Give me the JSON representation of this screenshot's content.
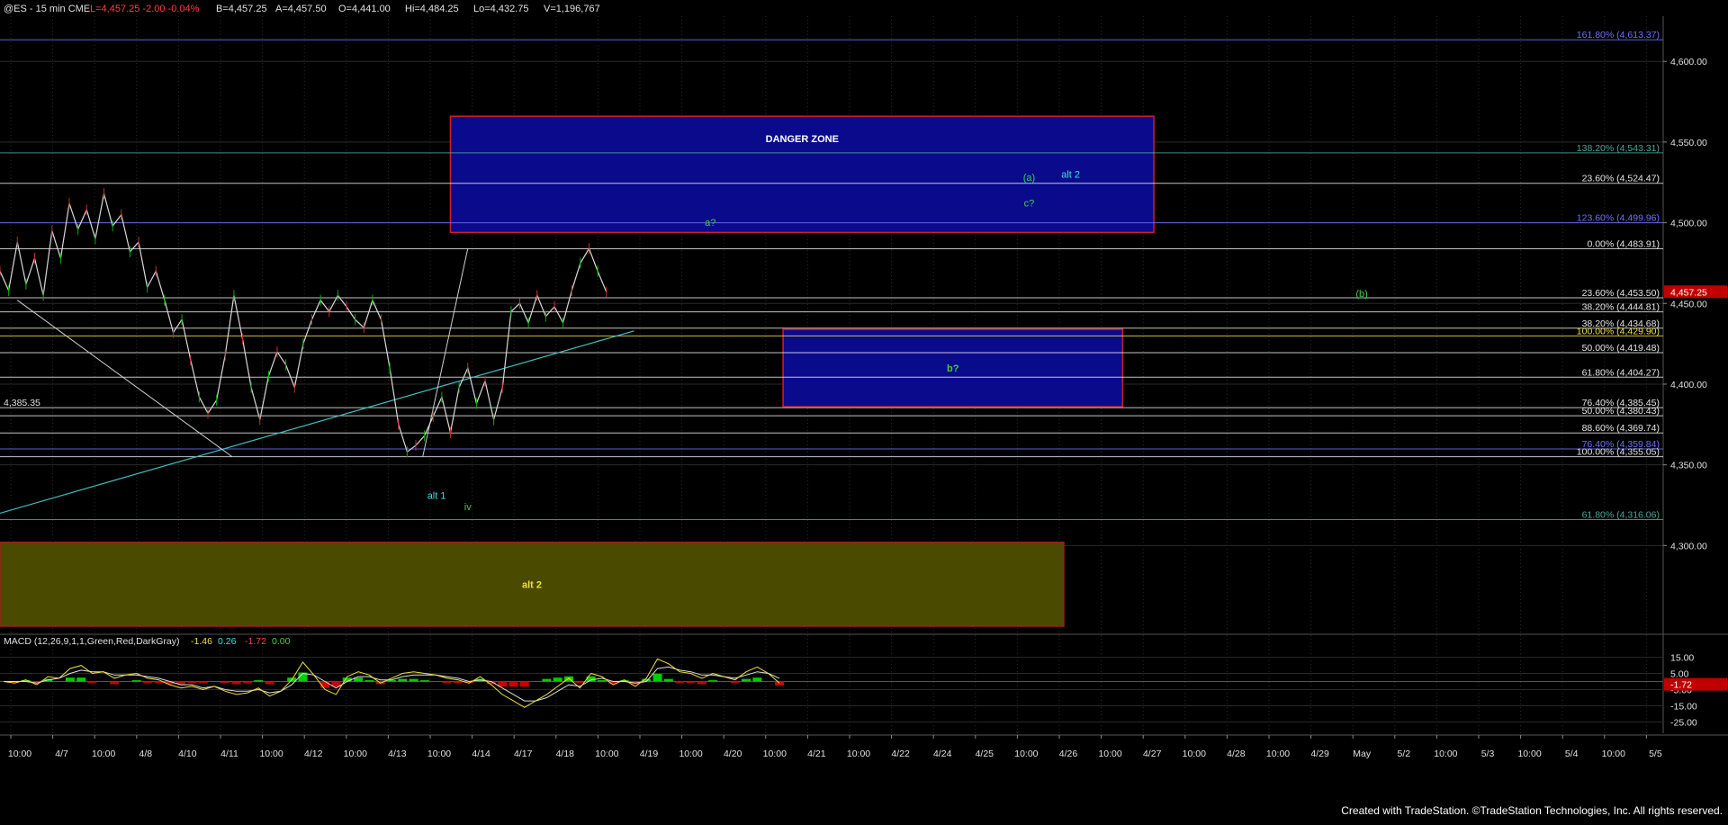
{
  "header": {
    "symbol": "@ES - 15 min  CME",
    "last": "L=4,457.25  -2.00  -0.04%",
    "bid": "B=4,457.25",
    "ask": "A=4,457.50",
    "open": "O=4,441.00",
    "high": "Hi=4,484.25",
    "low": "Lo=4,432.75",
    "volume": "V=1,196,767"
  },
  "colors": {
    "background": "#000000",
    "grid": "#2a2a2a",
    "price_line": "#d8d8d8",
    "fib_white": "#e6e6e6",
    "fib_yellow": "#f0e040",
    "fib_blue": "#7070ff",
    "fib_teal": "#4aa89a",
    "blue_box": "#0a0a8c",
    "blue_box_border": "#d02020",
    "olive_box": "#4a4a00",
    "label_green": "#40d040",
    "label_cyan": "#40e0e0",
    "macd_green": "#00cc00",
    "macd_red": "#cc0000",
    "price_tag": "#c00000"
  },
  "chart_data": {
    "type": "line",
    "title": "@ES - 15 min",
    "ylim": [
      4245,
      4628
    ],
    "y_ticks": [
      "4,600.00",
      "4,550.00",
      "4,500.00",
      "4,450.00",
      "4,400.00",
      "4,350.00",
      "4,300.00"
    ],
    "y_tick_values": [
      4600,
      4550,
      4500,
      4450,
      4400,
      4350,
      4300
    ],
    "x_ticks": [
      "10:00",
      "4/7",
      "10:00",
      "4/8",
      "4/10",
      "4/11",
      "10:00",
      "4/12",
      "10:00",
      "4/13",
      "10:00",
      "4/14",
      "4/17",
      "4/18",
      "10:00",
      "4/19",
      "10:00",
      "4/20",
      "10:00",
      "4/21",
      "10:00",
      "4/22",
      "4/24",
      "4/25",
      "10:00",
      "4/26",
      "10:00",
      "4/27",
      "10:00",
      "4/28",
      "10:00",
      "4/29",
      "May",
      "5/2",
      "10:00",
      "5/3",
      "10:00",
      "5/4",
      "10:00",
      "5/5"
    ],
    "price_series": {
      "name": "@ES",
      "x": [
        0,
        5,
        10,
        15,
        20,
        25,
        30,
        35,
        40,
        45,
        50,
        55,
        60,
        65,
        70,
        75,
        80,
        85,
        90,
        95,
        100,
        105,
        110,
        115,
        120,
        125,
        130,
        135,
        140,
        145,
        150,
        155,
        160,
        165,
        170,
        175,
        180,
        185,
        190,
        195,
        200,
        205,
        210,
        215,
        220,
        225,
        230,
        235,
        240,
        245,
        250,
        255,
        260,
        265,
        270,
        275,
        280,
        285,
        290,
        295,
        300,
        305,
        310,
        315,
        320,
        325,
        330,
        335,
        340,
        345,
        350
      ],
      "y": [
        4470,
        4458,
        4488,
        4462,
        4478,
        4455,
        4495,
        4478,
        4512,
        4496,
        4508,
        4490,
        4518,
        4498,
        4505,
        4482,
        4488,
        4460,
        4470,
        4452,
        4432,
        4440,
        4415,
        4392,
        4382,
        4390,
        4418,
        4455,
        4428,
        4398,
        4378,
        4405,
        4420,
        4412,
        4398,
        4425,
        4440,
        4452,
        4445,
        4455,
        4448,
        4440,
        4435,
        4452,
        4440,
        4410,
        4375,
        4358,
        4362,
        4368,
        4380,
        4392,
        4370,
        4398,
        4410,
        4388,
        4402,
        4378,
        4398,
        4445,
        4450,
        4438,
        4455,
        4442,
        4448,
        4438,
        4458,
        4475,
        4484,
        4470,
        4457
      ]
    },
    "fib_levels": [
      {
        "label": "161.80% (4,613.37)",
        "value": 4613.37,
        "color": "blue"
      },
      {
        "label": "138.20% (4,543.31)",
        "value": 4543.31,
        "color": "teal"
      },
      {
        "label": "23.60% (4,524.47)",
        "value": 4524.47,
        "color": "white"
      },
      {
        "label": "123.60% (4,499.96)",
        "value": 4499.96,
        "color": "blue"
      },
      {
        "label": "0.00% (4,483.91)",
        "value": 4483.91,
        "color": "white"
      },
      {
        "label": "23.60% (4,453.50)",
        "value": 4453.5,
        "color": "white"
      },
      {
        "label": "38.20% (4,444.81)",
        "value": 4444.81,
        "color": "white"
      },
      {
        "label": "38.20% (4,434.68)",
        "value": 4434.68,
        "color": "white"
      },
      {
        "label": "100.00% (4,429.90)",
        "value": 4429.9,
        "color": "yellow"
      },
      {
        "label": "50.00% (4,419.48)",
        "value": 4419.48,
        "color": "white"
      },
      {
        "label": "61.80% (4,404.27)",
        "value": 4404.27,
        "color": "white"
      },
      {
        "label": "76.40% (4,385.45)",
        "value": 4385.45,
        "color": "white"
      },
      {
        "label": "50.00% (4,380.43)",
        "value": 4380.43,
        "color": "white"
      },
      {
        "label": "88.60% (4,369.74)",
        "value": 4369.74,
        "color": "white"
      },
      {
        "label": "76.40% (4,359.84)",
        "value": 4359.84,
        "color": "blue"
      },
      {
        "label": "100.00% (4,355.05)",
        "value": 4355.05,
        "color": "white"
      },
      {
        "label": "61.80% (4,316.06)",
        "value": 4316.06,
        "color": "teal"
      }
    ],
    "zones": [
      {
        "label": "DANGER ZONE",
        "y_high": 4566,
        "y_low": 4494,
        "x_from": 130,
        "x_to": 333,
        "fill": "blue"
      },
      {
        "label": "b?",
        "y_high": 4434,
        "y_low": 4386,
        "x_from": 226,
        "x_to": 324,
        "fill": "blue"
      },
      {
        "label": "alt 2",
        "y_high": 4302,
        "y_low": 4250,
        "x_from": 0,
        "x_to": 307,
        "fill": "olive"
      }
    ],
    "wave_labels": [
      {
        "text": "a?",
        "x": 205,
        "y": 4498,
        "color": "green"
      },
      {
        "text": "(a)",
        "x": 297,
        "y": 4526,
        "color": "green"
      },
      {
        "text": "alt 2",
        "x": 309,
        "y": 4528,
        "color": "cyan"
      },
      {
        "text": "c?",
        "x": 297,
        "y": 4510,
        "color": "green"
      },
      {
        "text": "(b)",
        "x": 393,
        "y": 4454,
        "color": "green"
      },
      {
        "text": "alt 1",
        "x": 126,
        "y": 4329,
        "color": "cyan"
      },
      {
        "text": "iv",
        "x": 135,
        "y": 4322,
        "color": "green"
      }
    ],
    "left_label": "4,385.35",
    "last_price_tag": "4,457.25",
    "macd": {
      "label": "MACD (12,26,9,1,1,Green,Red,DarkGray)",
      "values": [
        "-1.46",
        "0.26",
        "-1.72",
        "0.00"
      ],
      "ylim": [
        -32,
        22
      ],
      "y_ticks": [
        "15.00",
        "5.00",
        "-5.00",
        "-15.00",
        "-25.00"
      ],
      "y_tick_values": [
        15,
        5,
        -5,
        -15,
        -25
      ],
      "last_tag": "-1.72",
      "line": [
        0,
        -1,
        1,
        -2,
        3,
        2,
        8,
        10,
        5,
        6,
        2,
        4,
        5,
        2,
        1,
        -2,
        -4,
        -3,
        -5,
        -3,
        -6,
        -8,
        -7,
        -4,
        -9,
        -6,
        1,
        12,
        4,
        -5,
        -8,
        3,
        6,
        4,
        -1,
        2,
        5,
        6,
        5,
        4,
        2,
        1,
        -1,
        3,
        -2,
        -8,
        -12,
        -16,
        -12,
        -8,
        -3,
        2,
        -4,
        5,
        3,
        -2,
        1,
        -3,
        2,
        14,
        11,
        6,
        5,
        2,
        5,
        3,
        1,
        6,
        9,
        5,
        -1
      ],
      "signal": [
        0,
        0,
        0,
        -1,
        1,
        2,
        5,
        7,
        6,
        6,
        4,
        4,
        4,
        3,
        2,
        0,
        -2,
        -2,
        -4,
        -3,
        -5,
        -6,
        -6,
        -5,
        -7,
        -6,
        -2,
        5,
        4,
        0,
        -4,
        0,
        3,
        3,
        1,
        1,
        3,
        4,
        4,
        4,
        3,
        2,
        0,
        1,
        0,
        -4,
        -8,
        -12,
        -12,
        -10,
        -6,
        -2,
        -3,
        1,
        2,
        0,
        0,
        -1,
        0,
        8,
        9,
        7,
        6,
        4,
        4,
        3,
        2,
        4,
        6,
        5,
        2
      ]
    }
  },
  "footer": {
    "text": "Created with TradeStation. ©TradeStation Technologies, Inc. All rights reserved."
  }
}
